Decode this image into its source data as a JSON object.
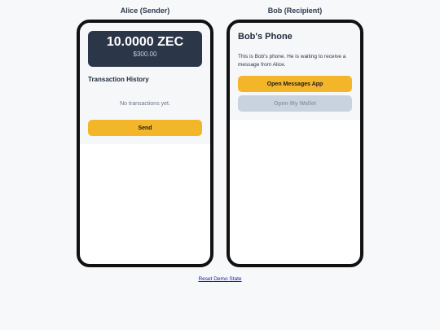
{
  "alice": {
    "title": "Alice (Sender)",
    "balance_zec": "10.0000 ZEC",
    "balance_usd": "$300.00",
    "history_title": "Transaction History",
    "empty_text": "No transactions yet.",
    "send_label": "Send"
  },
  "bob": {
    "title": "Bob (Recipient)",
    "heading": "Bob's Phone",
    "description": "This is Bob's phone. He is waiting to receive a message from Alice.",
    "open_messages_label": "Open Messages App",
    "open_wallet_label": "Open My Wallet"
  },
  "footer": {
    "reset_label": "Reset Demo State"
  },
  "colors": {
    "accent": "#f3b52a",
    "card": "#2b3648",
    "disabled": "#c9d3df"
  }
}
